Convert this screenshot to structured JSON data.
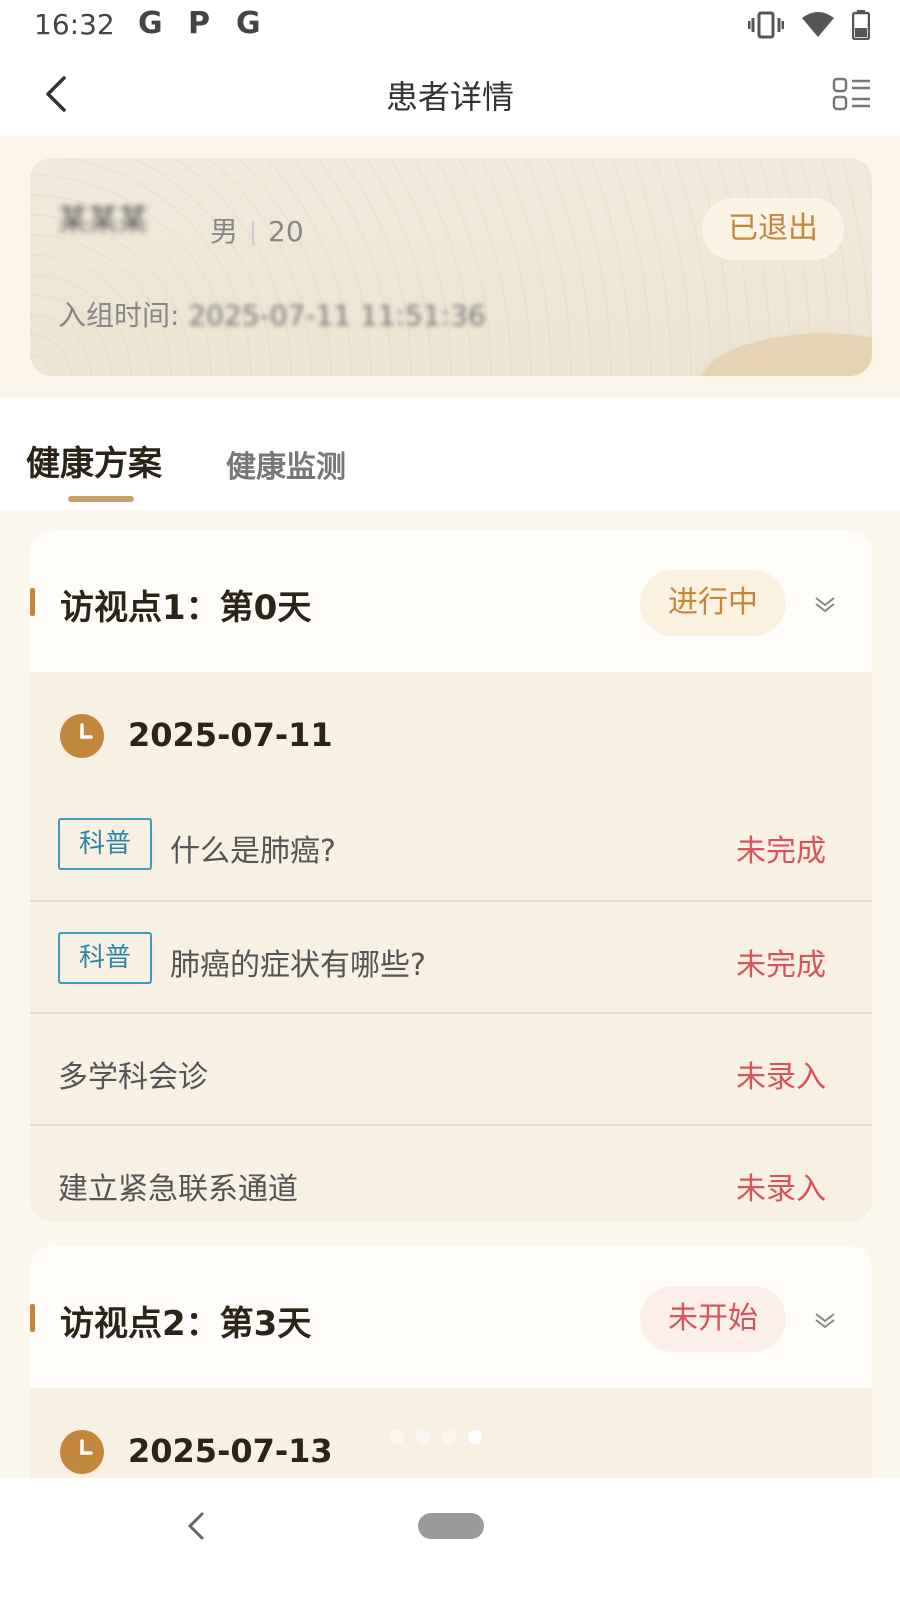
{
  "status_bar": {
    "time": "16:32",
    "notifications": [
      "G",
      "P",
      "G"
    ]
  },
  "header": {
    "title": "患者详情",
    "back_icon": "chevron-left-icon",
    "menu_icon": "list-layout-icon"
  },
  "patient": {
    "name": "某某某",
    "gender": "男",
    "age": "20",
    "status_badge": "已退出",
    "enroll_label": "入组时间:",
    "enroll_value": "2025-07-11 11:51:36"
  },
  "tabs": [
    {
      "label": "健康方案",
      "active": true
    },
    {
      "label": "健康监测",
      "active": false
    }
  ],
  "visits": [
    {
      "title": "访视点1：第0天",
      "status": "进行中",
      "date": "2025-07-11",
      "tasks": [
        {
          "tag": "科普",
          "name": "什么是肺癌?",
          "status": "未完成"
        },
        {
          "tag": "科普",
          "name": "肺癌的症状有哪些?",
          "status": "未完成"
        },
        {
          "tag": "",
          "name": "多学科会诊",
          "status": "未录入"
        },
        {
          "tag": "",
          "name": "建立紧急联系通道",
          "status": "未录入"
        }
      ]
    },
    {
      "title": "访视点2：第3天",
      "status": "未开始",
      "date": "2025-07-13",
      "tasks": []
    }
  ],
  "colors": {
    "accent": "#c2873c",
    "pending_red": "#d8545a",
    "tag_blue": "#2c86a8",
    "in_progress_bg": "#fbf1df",
    "not_started_bg": "#fcefe9"
  }
}
